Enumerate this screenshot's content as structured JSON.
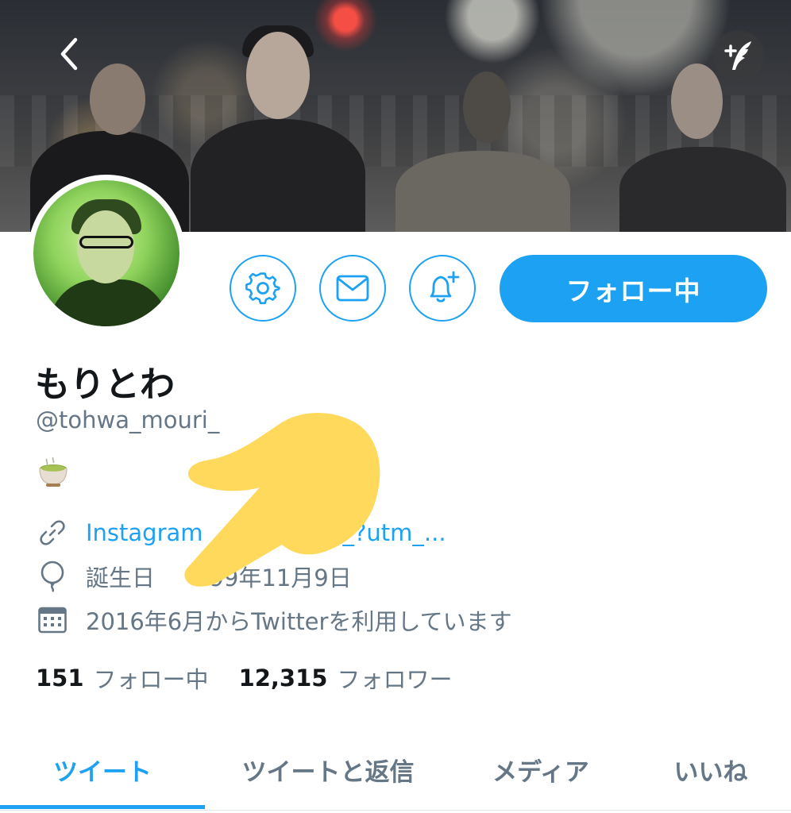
{
  "header": {
    "back_icon": "chevron-left-icon",
    "compose_icon": "compose-quill-icon"
  },
  "actions": {
    "settings_icon": "gear-icon",
    "message_icon": "envelope-icon",
    "notify_icon": "bell-plus-icon",
    "follow_label": "フォロー中"
  },
  "profile": {
    "display_name": "もりとわ",
    "handle": "@tohwa_mouri_",
    "bio_emoji": "🍵"
  },
  "info": {
    "link_text": "Instagram.com/tohwa_mouri_?utm_...",
    "link_visible_start": "Instagram",
    "link_visible_end": "om_?utm_...",
    "birthday": "誕生日 1999年11月9日",
    "birthday_visible_start": "誕生日",
    "birthday_visible_end": "999年11月9日",
    "joined": "2016年6月からTwitterを利用しています"
  },
  "stats": {
    "following_count": "151",
    "following_label": "フォロー中",
    "followers_count": "12,315",
    "followers_label": "フォロワー"
  },
  "tabs": [
    {
      "label": "ツイート",
      "active": true
    },
    {
      "label": "ツイートと返信",
      "active": false
    },
    {
      "label": "メディア",
      "active": false
    },
    {
      "label": "いいね",
      "active": false
    }
  ],
  "colors": {
    "accent": "#1da1f2",
    "secondary_text": "#657786",
    "primary_text": "#14171a",
    "overlay_finger": "#ffd95c"
  }
}
